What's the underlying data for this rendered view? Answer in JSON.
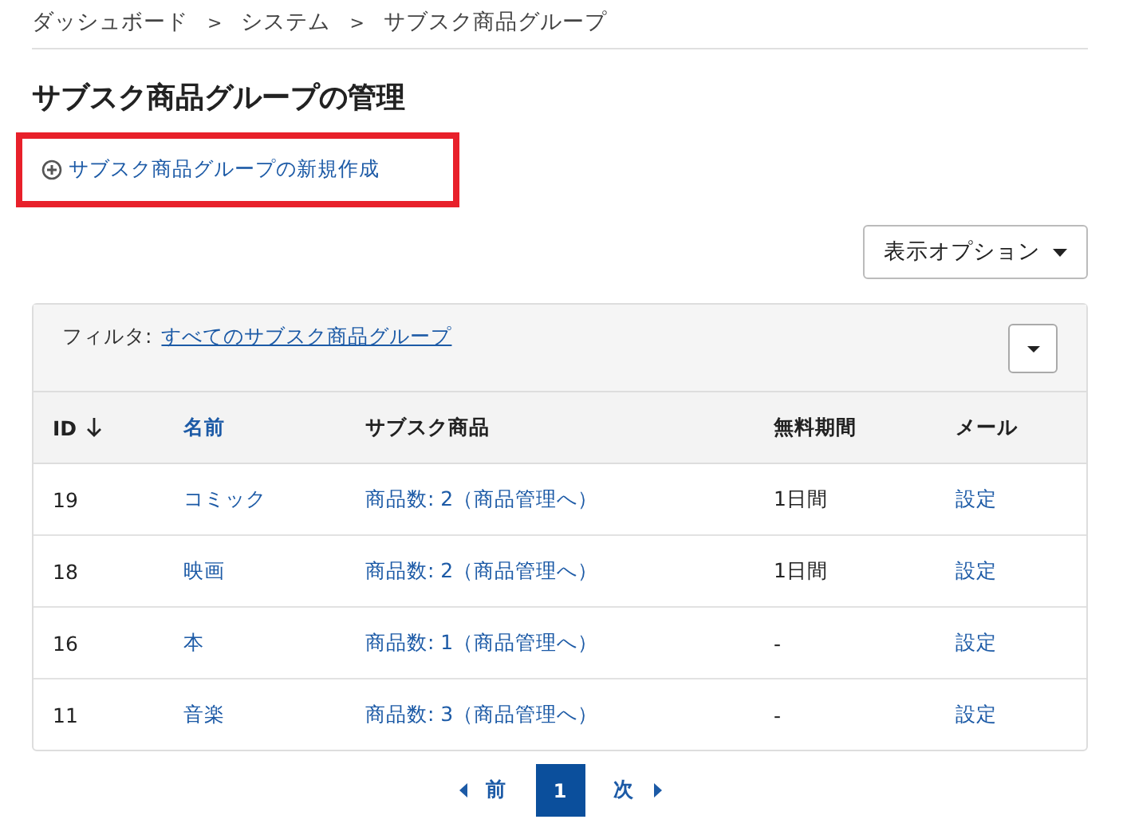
{
  "breadcrumb": [
    "ダッシュボード",
    "システム",
    "サブスク商品グループ"
  ],
  "breadcrumb_separator": ">",
  "heading": "サブスク商品グループの管理",
  "create_link": {
    "label": "サブスク商品グループの新規作成",
    "highlighted": true
  },
  "options_button": {
    "label": "表示オプション"
  },
  "filter": {
    "label": "フィルタ:",
    "value": "すべてのサブスク商品グループ"
  },
  "table": {
    "columns": [
      {
        "label": "ID",
        "sorted": true,
        "link": false,
        "cell_link": false
      },
      {
        "label": "名前",
        "sorted": false,
        "link": true,
        "cell_link": true
      },
      {
        "label": "サブスク商品",
        "sorted": false,
        "link": false,
        "cell_link": true
      },
      {
        "label": "無料期間",
        "sorted": false,
        "link": false,
        "cell_link": false
      },
      {
        "label": "メール",
        "sorted": false,
        "link": false,
        "cell_link": true
      }
    ],
    "rows": [
      [
        "19",
        "コミック",
        "商品数: 2（商品管理へ）",
        "1日間",
        "設定"
      ],
      [
        "18",
        "映画",
        "商品数: 2（商品管理へ）",
        "1日間",
        "設定"
      ],
      [
        "16",
        "本",
        "商品数: 1（商品管理へ）",
        "-",
        "設定"
      ],
      [
        "11",
        "音楽",
        "商品数: 3（商品管理へ）",
        "-",
        "設定"
      ]
    ]
  },
  "pagination": {
    "previous": "前",
    "next": "次",
    "pages": [
      {
        "label": "1",
        "selected": true
      }
    ]
  }
}
